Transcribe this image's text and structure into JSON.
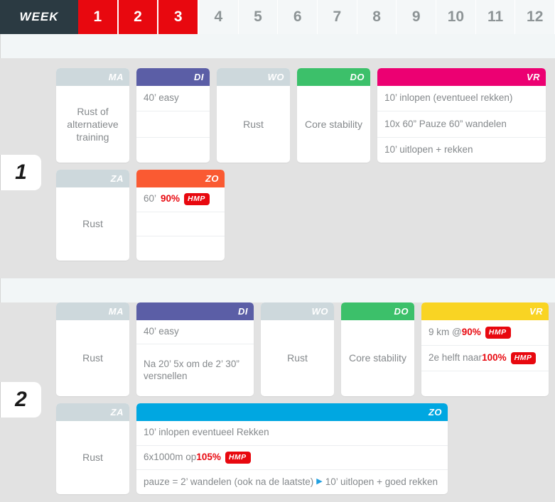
{
  "weekbar": {
    "label": "WEEK",
    "tabs": [
      {
        "num": "1",
        "active": true
      },
      {
        "num": "2",
        "active": true
      },
      {
        "num": "3",
        "active": true
      },
      {
        "num": "4",
        "active": false
      },
      {
        "num": "5",
        "active": false
      },
      {
        "num": "6",
        "active": false
      },
      {
        "num": "7",
        "active": false
      },
      {
        "num": "8",
        "active": false
      },
      {
        "num": "9",
        "active": false
      },
      {
        "num": "10",
        "active": false
      },
      {
        "num": "11",
        "active": false
      },
      {
        "num": "12",
        "active": false
      }
    ]
  },
  "colors": {
    "active_tab": "#e8080f",
    "week_label_bg": "#2b3a42",
    "rest_day": "#cdd8dc",
    "di_purple": "#5b5ea6",
    "do_green": "#3cc06a",
    "vr_pink": "#ec0072",
    "vr_yellow": "#f9d423",
    "zo_orange": "#fa5a32",
    "zo_blue": "#00a7e1",
    "accent_red": "#e8080f",
    "arrow_blue": "#1f9fe0",
    "page_bg": "#e2e2e2",
    "band_bg": "#f2f6f7"
  },
  "weeks": [
    {
      "number": "1",
      "row1": {
        "ma": {
          "day": "MA",
          "text": "Rust of alternatieve training"
        },
        "di": {
          "day": "DI",
          "lines": [
            "40’ easy",
            "",
            ""
          ]
        },
        "wo": {
          "day": "WO",
          "text": "Rust"
        },
        "do": {
          "day": "DO",
          "text": "Core stability"
        },
        "vr": {
          "day": "VR",
          "lines": [
            "10’ inlopen (eventueel rekken)",
            "10x 60” Pauze 60” wandelen",
            "10’ uitlopen + rekken"
          ]
        }
      },
      "row2": {
        "za": {
          "day": "ZA",
          "text": "Rust"
        },
        "zo": {
          "day": "ZO",
          "line1_dur": "60’",
          "line1_pct": "90%",
          "line1_badge": "HMP"
        }
      }
    },
    {
      "number": "2",
      "row1": {
        "ma": {
          "day": "MA",
          "text": "Rust"
        },
        "di": {
          "day": "DI",
          "lines": [
            "40’ easy",
            "Na 20’ 5x om de 2’ 30” versnellen"
          ]
        },
        "wo": {
          "day": "WO",
          "text": "Rust"
        },
        "do": {
          "day": "DO",
          "text": "Core stability"
        },
        "vr": {
          "day": "VR",
          "l1_pre": "9 km @ ",
          "l1_pct": "90%",
          "l1_badge": "HMP",
          "l2_pre": "2e helft naar ",
          "l2_pct": "100%",
          "l2_badge": "HMP"
        }
      },
      "row2": {
        "za": {
          "day": "ZA",
          "text": "Rust"
        },
        "zo": {
          "day": "ZO",
          "l1": "10’ inlopen eventueel Rekken",
          "l2_pre": "6x1000m op ",
          "l2_pct": "105%",
          "l2_badge": "HMP",
          "l3_pre": "pauze = 2’ wandelen (ook na de laatste)",
          "l3_arrow": "▶",
          "l3_post": "10’ uitlopen + goed rekken"
        }
      }
    }
  ]
}
